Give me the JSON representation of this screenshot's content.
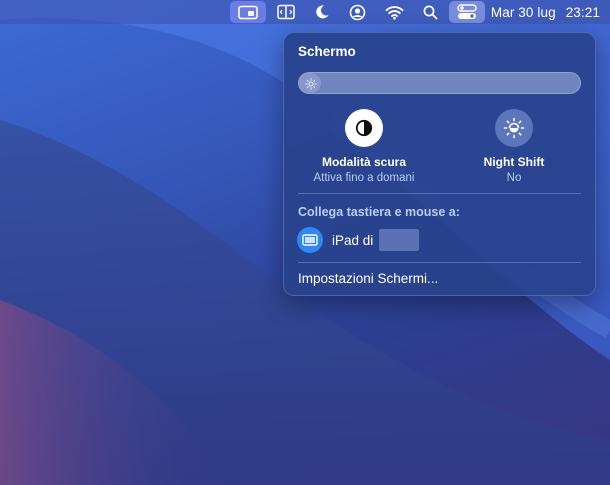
{
  "menubar": {
    "icons": [
      "display-mirror-icon",
      "split-screen-icon",
      "moon-icon",
      "user-circle-icon",
      "wifi-icon",
      "search-icon",
      "control-center-icon"
    ],
    "date": "Mar 30 lug",
    "time": "23:21"
  },
  "panel": {
    "title": "Schermo",
    "brightness": {
      "icon": "sun-small-icon",
      "level": 0.08
    },
    "dark_mode": {
      "icon": "dark-mode-icon",
      "label": "Modalità scura",
      "status": "Attiva fino a domani",
      "state": "on"
    },
    "night_shift": {
      "icon": "night-shift-sun-icon",
      "label": "Night Shift",
      "status": "No",
      "state": "off"
    },
    "keyboard_mouse": {
      "title": "Collega tastiera e mouse a:",
      "device_icon": "ipad-icon",
      "device_label": "iPad di"
    },
    "settings_link": "Impostazioni Schermi..."
  },
  "colors": {
    "panel_bg": "#28428c",
    "accent_blue": "#2f86f5",
    "subtext": "#b9cdf4"
  }
}
